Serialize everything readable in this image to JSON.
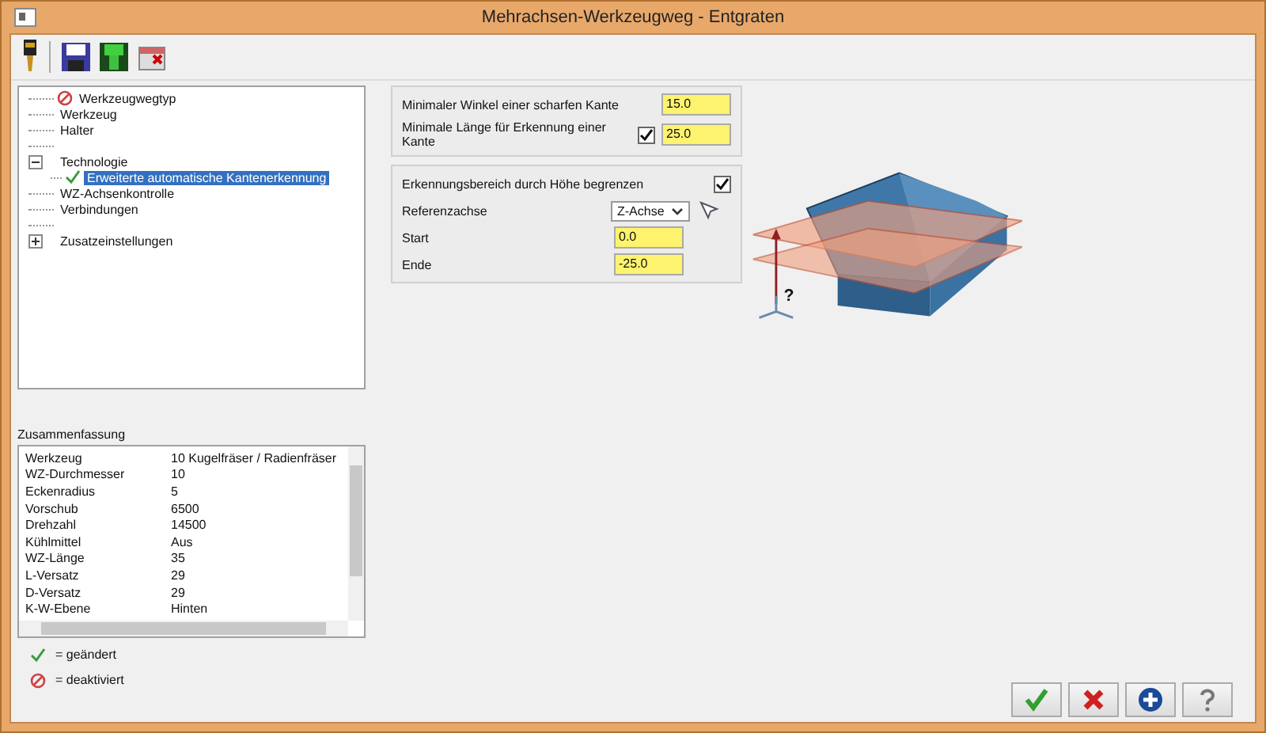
{
  "window": {
    "title": "Mehrachsen-Werkzeugweg - Entgraten"
  },
  "tree": [
    {
      "label": "Werkzeugwegtyp",
      "kind": "item",
      "deactivated": true,
      "changed": false,
      "selected": false
    },
    {
      "label": "Werkzeug",
      "kind": "item",
      "deactivated": false,
      "changed": false,
      "selected": false
    },
    {
      "label": "Halter",
      "kind": "item",
      "deactivated": false,
      "changed": false,
      "selected": false
    },
    {
      "kind": "spacer"
    },
    {
      "label": "Technologie",
      "kind": "item",
      "expanded": true,
      "deactivated": false,
      "changed": false,
      "selected": false,
      "children": [
        {
          "label": "Erweiterte automatische Kantenerkennung",
          "kind": "item",
          "deactivated": false,
          "changed": true,
          "selected": true
        }
      ]
    },
    {
      "label": "WZ-Achsenkontrolle",
      "kind": "item",
      "deactivated": false,
      "changed": false,
      "selected": false
    },
    {
      "label": "Verbindungen",
      "kind": "item",
      "deactivated": false,
      "changed": false,
      "selected": false
    },
    {
      "kind": "spacer"
    },
    {
      "label": "Zusatzeinstellungen",
      "kind": "item",
      "expanded": false,
      "deactivated": false,
      "changed": false,
      "selected": false
    }
  ],
  "summary": {
    "title": "Zusammenfassung",
    "rows": [
      {
        "key": "Werkzeug",
        "value": "10 Kugelfräser / Radienfräser"
      },
      {
        "key": "WZ-Durchmesser",
        "value": "10"
      },
      {
        "key": "Eckenradius",
        "value": "5"
      },
      {
        "key": "Vorschub",
        "value": "6500"
      },
      {
        "key": "Drehzahl",
        "value": "14500"
      },
      {
        "key": "Kühlmittel",
        "value": "Aus"
      },
      {
        "key": "WZ-Länge",
        "value": "35"
      },
      {
        "key": "L-Versatz",
        "value": "29"
      },
      {
        "key": "D-Versatz",
        "value": "29"
      },
      {
        "key": "K-W-Ebene",
        "value": "Hinten"
      }
    ]
  },
  "legend": [
    {
      "kind": "changed",
      "text": "= geändert"
    },
    {
      "kind": "deactivated",
      "text": "= deaktiviert"
    }
  ],
  "drawing": {
    "label": "?"
  },
  "edge_group": {
    "fields": [
      {
        "label": "Minimaler Winkel einer scharfen Kante",
        "value": "15.0"
      },
      {
        "label": "Minimale Länge für Erkennung einer Kante",
        "value": "25.0",
        "checked": true
      }
    ]
  },
  "height_group": {
    "label": "Erkennungsbereich durch Höhe begrenzen",
    "checked": true,
    "axis": {
      "label": "Referenzachse",
      "value": "Z-Achse"
    },
    "fields": [
      {
        "label": "Start",
        "value": "0.0"
      },
      {
        "label": "Ende",
        "value": "-25.0"
      }
    ]
  },
  "buttons": [
    {
      "kind": "ok"
    },
    {
      "kind": "cancel"
    },
    {
      "kind": "add"
    },
    {
      "kind": "help"
    }
  ]
}
